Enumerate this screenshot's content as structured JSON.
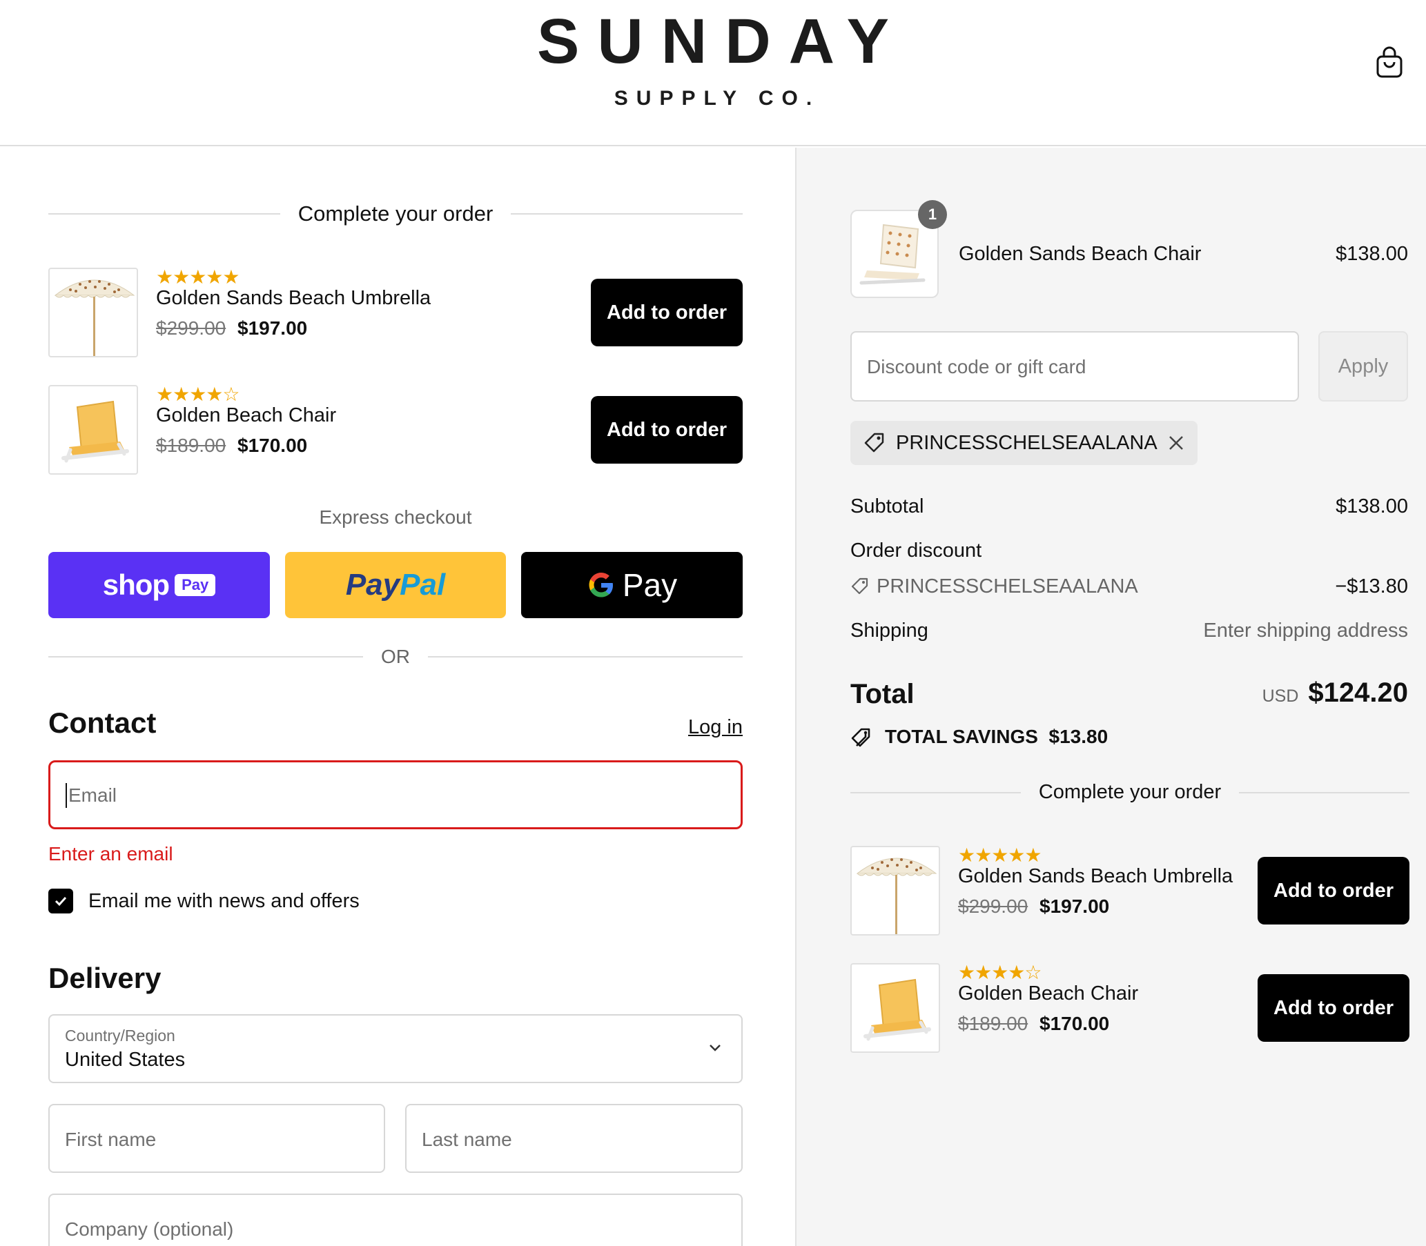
{
  "header": {
    "brand_main": "SUNDAY",
    "brand_sub": "SUPPLY CO.",
    "cart_icon": "shopping-bag-icon"
  },
  "left": {
    "upsell_heading": "Complete your order",
    "upsells": [
      {
        "name": "Golden Sands Beach Umbrella",
        "old_price": "$299.00",
        "new_price": "$197.00",
        "rating": 5,
        "stars": "★★★★★",
        "button": "Add to order"
      },
      {
        "name": "Golden Beach Chair",
        "old_price": "$189.00",
        "new_price": "$170.00",
        "rating": 4.5,
        "stars": "★★★★☆",
        "button": "Add to order"
      }
    ],
    "express_label": "Express checkout",
    "express_buttons": {
      "shop_text": "shop",
      "shop_pay": "Pay",
      "paypal_a": "Pay",
      "paypal_b": "Pal",
      "gpay_g": "G",
      "gpay_text": "Pay"
    },
    "or_text": "OR",
    "contact": {
      "title": "Contact",
      "login": "Log in",
      "email_placeholder": "Email",
      "email_error": "Enter an email",
      "newsletter_label": "Email me with news and offers",
      "newsletter_checked": true
    },
    "delivery": {
      "title": "Delivery",
      "country_label": "Country/Region",
      "country_value": "United States",
      "first_name_placeholder": "First name",
      "last_name_placeholder": "Last name",
      "company_placeholder": "Company (optional)"
    }
  },
  "right": {
    "cart_item": {
      "quantity": "1",
      "name": "Golden Sands Beach Chair",
      "price": "$138.00"
    },
    "discount_placeholder": "Discount code or gift card",
    "apply_label": "Apply",
    "applied_code": "PRINCESSCHELSEAALANA",
    "subtotal_label": "Subtotal",
    "subtotal_value": "$138.00",
    "order_discount_label": "Order discount",
    "discount_code": "PRINCESSCHELSEAALANA",
    "discount_value": "−$13.80",
    "shipping_label": "Shipping",
    "shipping_value": "Enter shipping address",
    "total_label": "Total",
    "total_currency": "USD",
    "total_value": "$124.20",
    "savings_label": "TOTAL SAVINGS",
    "savings_value": "$13.80",
    "upsell_heading": "Complete your order",
    "upsells": [
      {
        "name": "Golden Sands Beach Umbrella",
        "old_price": "$299.00",
        "new_price": "$197.00",
        "rating": 5,
        "stars": "★★★★★",
        "button": "Add to order"
      },
      {
        "name": "Golden Beach Chair",
        "old_price": "$189.00",
        "new_price": "$170.00",
        "rating": 4.5,
        "stars": "★★★★☆",
        "button": "Add to order"
      }
    ]
  },
  "colors": {
    "shop_pay": "#5a31f4",
    "paypal": "#ffc439",
    "error": "#d91b1b",
    "star": "#f0a500"
  }
}
